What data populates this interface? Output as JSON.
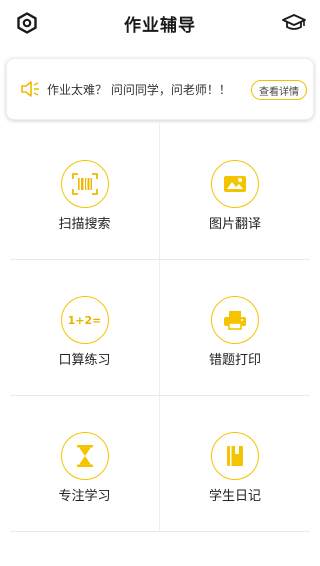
{
  "header": {
    "title": "作业辅导",
    "left_icon": "settings-hexagon-icon",
    "right_icon": "graduation-cap-icon"
  },
  "notice": {
    "icon": "speaker-icon",
    "text": "作业太难？ 问问同学，问老师！！",
    "detail_button": "查看详情"
  },
  "features": [
    {
      "label": "扫描搜索",
      "icon": "barcode-scan-icon"
    },
    {
      "label": "图片翻译",
      "icon": "image-icon"
    },
    {
      "label": "口算练习",
      "icon": "math-icon",
      "icon_text": "1+2="
    },
    {
      "label": "错题打印",
      "icon": "printer-icon"
    },
    {
      "label": "专注学习",
      "icon": "hourglass-icon"
    },
    {
      "label": "学生日记",
      "icon": "diary-book-icon"
    }
  ],
  "colors": {
    "accent": "#F5C400",
    "divider": "#E9E9E9",
    "text": "#222222"
  }
}
